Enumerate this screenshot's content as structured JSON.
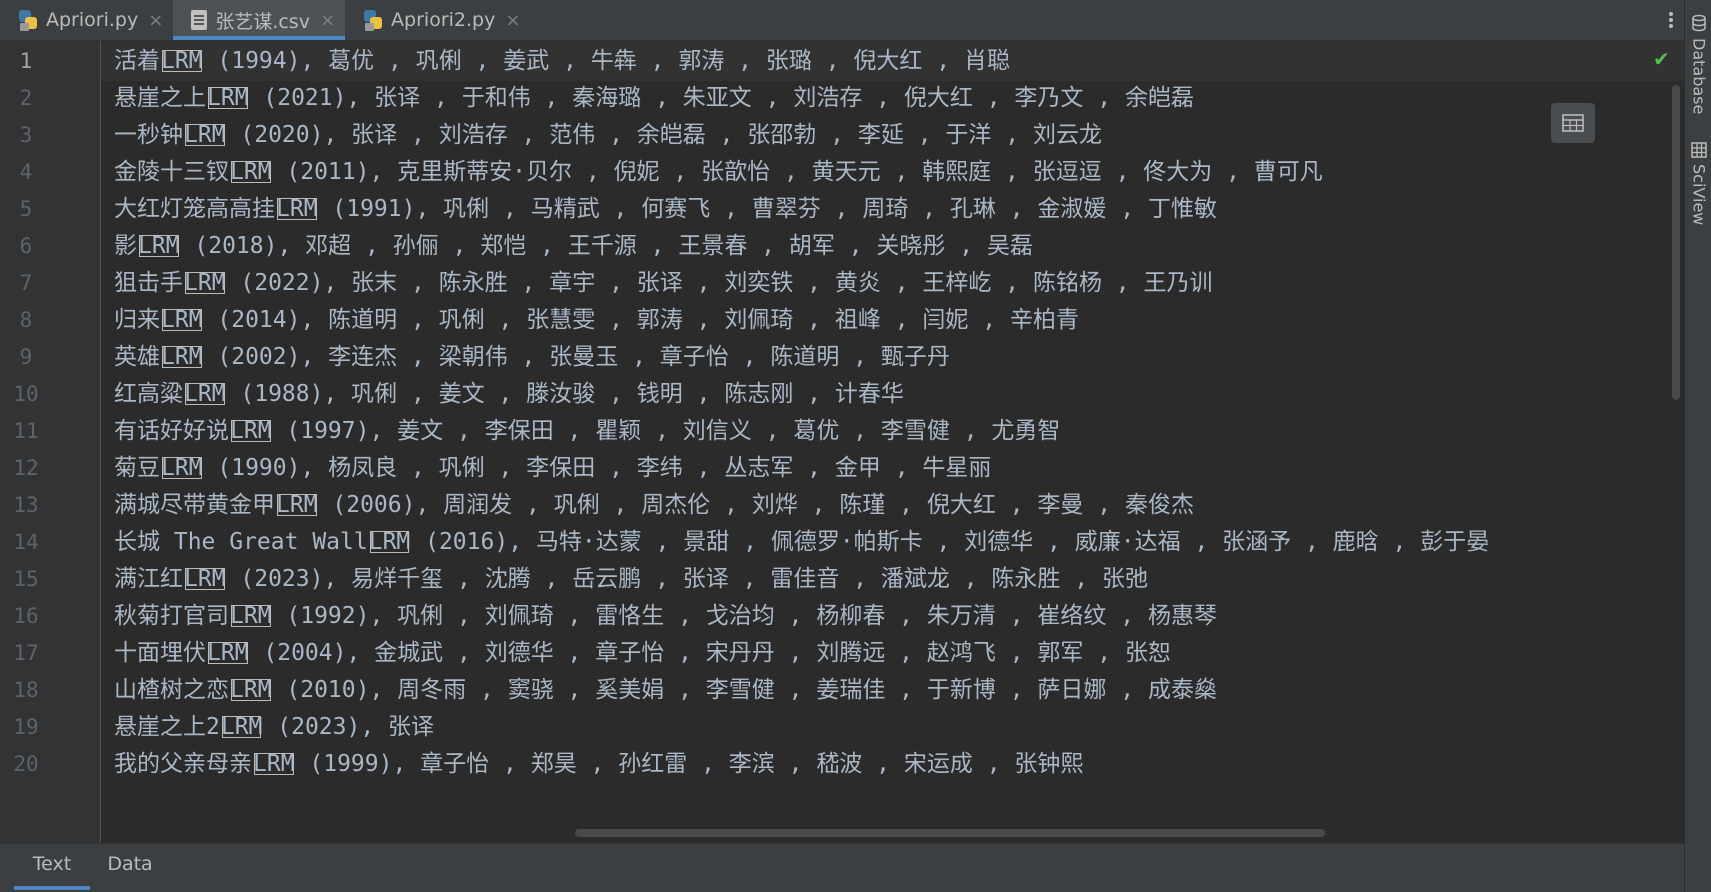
{
  "tabs": [
    {
      "label": "Apriori.py",
      "icon": "python-file-icon"
    },
    {
      "label": "张艺谋.csv",
      "icon": "csv-file-icon",
      "active": true
    },
    {
      "label": "Apriori2.py",
      "icon": "python-file-icon"
    }
  ],
  "right_tools": [
    "Database",
    "SciView"
  ],
  "bottom_tabs": [
    {
      "label": "Text",
      "active": true
    },
    {
      "label": "Data"
    }
  ],
  "lines": [
    {
      "num": "1",
      "title": "活着",
      "tag": "LRM",
      "rest": " (1994), 葛优 , 巩俐 , 姜武 , 牛犇 , 郭涛 , 张璐 , 倪大红 , 肖聪"
    },
    {
      "num": "2",
      "title": "悬崖之上",
      "tag": "LRM",
      "rest": " (2021), 张译 , 于和伟 , 秦海璐 , 朱亚文 , 刘浩存 , 倪大红 , 李乃文 , 余皑磊"
    },
    {
      "num": "3",
      "title": "一秒钟",
      "tag": "LRM",
      "rest": " (2020), 张译 , 刘浩存 , 范伟 , 余皑磊 , 张邵勃 , 李延 , 于洋 , 刘云龙"
    },
    {
      "num": "4",
      "title": "金陵十三钗",
      "tag": "LRM",
      "rest": " (2011), 克里斯蒂安·贝尔 , 倪妮 , 张歆怡 , 黄天元 , 韩熙庭 , 张逗逗 , 佟大为 , 曹可凡"
    },
    {
      "num": "5",
      "title": "大红灯笼高高挂",
      "tag": "LRM",
      "rest": " (1991), 巩俐 , 马精武 , 何赛飞 , 曹翠芬 , 周琦 , 孔琳 , 金淑媛 , 丁惟敏"
    },
    {
      "num": "6",
      "title": "影",
      "tag": "LRM",
      "rest": " (2018), 邓超 , 孙俪 , 郑恺 , 王千源 , 王景春 , 胡军 , 关晓彤 , 吴磊"
    },
    {
      "num": "7",
      "title": "狙击手",
      "tag": "LRM",
      "rest": " (2022), 张末 , 陈永胜 , 章宇 , 张译 , 刘奕铁 , 黄炎 , 王梓屹 , 陈铭杨 , 王乃训"
    },
    {
      "num": "8",
      "title": "归来",
      "tag": "LRM",
      "rest": " (2014), 陈道明 , 巩俐 , 张慧雯 , 郭涛 , 刘佩琦 , 祖峰 , 闫妮 , 辛柏青"
    },
    {
      "num": "9",
      "title": "英雄",
      "tag": "LRM",
      "rest": " (2002), 李连杰 , 梁朝伟 , 张曼玉 , 章子怡 , 陈道明 , 甄子丹"
    },
    {
      "num": "10",
      "title": "红高粱",
      "tag": "LRM",
      "rest": " (1988), 巩俐 , 姜文 , 滕汝骏 , 钱明 , 陈志刚 , 计春华"
    },
    {
      "num": "11",
      "title": "有话好好说",
      "tag": "LRM",
      "rest": " (1997), 姜文 , 李保田 , 瞿颖 , 刘信义 , 葛优 , 李雪健 , 尤勇智"
    },
    {
      "num": "12",
      "title": "菊豆",
      "tag": "LRM",
      "rest": " (1990), 杨凤良 , 巩俐 , 李保田 , 李纬 , 丛志军 , 金甲 , 牛星丽"
    },
    {
      "num": "13",
      "title": "满城尽带黄金甲",
      "tag": "LRM",
      "rest": " (2006), 周润发 , 巩俐 , 周杰伦 , 刘烨 , 陈瑾 , 倪大红 , 李曼 , 秦俊杰"
    },
    {
      "num": "14",
      "title": "长城 The Great Wall",
      "tag": "LRM",
      "rest": " (2016), 马特·达蒙 , 景甜 , 佩德罗·帕斯卡 , 刘德华 , 威廉·达福 , 张涵予 , 鹿晗 , 彭于晏"
    },
    {
      "num": "15",
      "title": "满江红",
      "tag": "LRM",
      "rest": " (2023), 易烊千玺 , 沈腾 , 岳云鹏 , 张译 , 雷佳音 , 潘斌龙 , 陈永胜 , 张弛"
    },
    {
      "num": "16",
      "title": "秋菊打官司",
      "tag": "LRM",
      "rest": " (1992), 巩俐 , 刘佩琦 , 雷恪生 , 戈治均 , 杨柳春 , 朱万清 , 崔络纹 , 杨惠琴"
    },
    {
      "num": "17",
      "title": "十面埋伏",
      "tag": "LRM",
      "rest": " (2004), 金城武 , 刘德华 , 章子怡 , 宋丹丹 , 刘腾远 , 赵鸿飞 , 郭军 , 张恕"
    },
    {
      "num": "18",
      "title": "山楂树之恋",
      "tag": "LRM",
      "rest": " (2010), 周冬雨 , 窦骁 , 奚美娟 , 李雪健 , 姜瑞佳 , 于新博 , 萨日娜 , 成泰燊"
    },
    {
      "num": "19",
      "title": "悬崖之上2",
      "tag": "LRM",
      "rest": " (2023), 张译"
    },
    {
      "num": "20",
      "title": "我的父亲母亲",
      "tag": "LRM",
      "rest": " (1999), 章子怡 , 郑昊 , 孙红雷 , 李滨 , 嵇波 , 宋运成 , 张钟熙"
    }
  ],
  "colors": {
    "editor_bg": "#2b2b2b",
    "gutter_bg": "#313335",
    "tab_accent": "#4a88c7",
    "text": "#a9b7c6",
    "check": "#4fc04f"
  }
}
